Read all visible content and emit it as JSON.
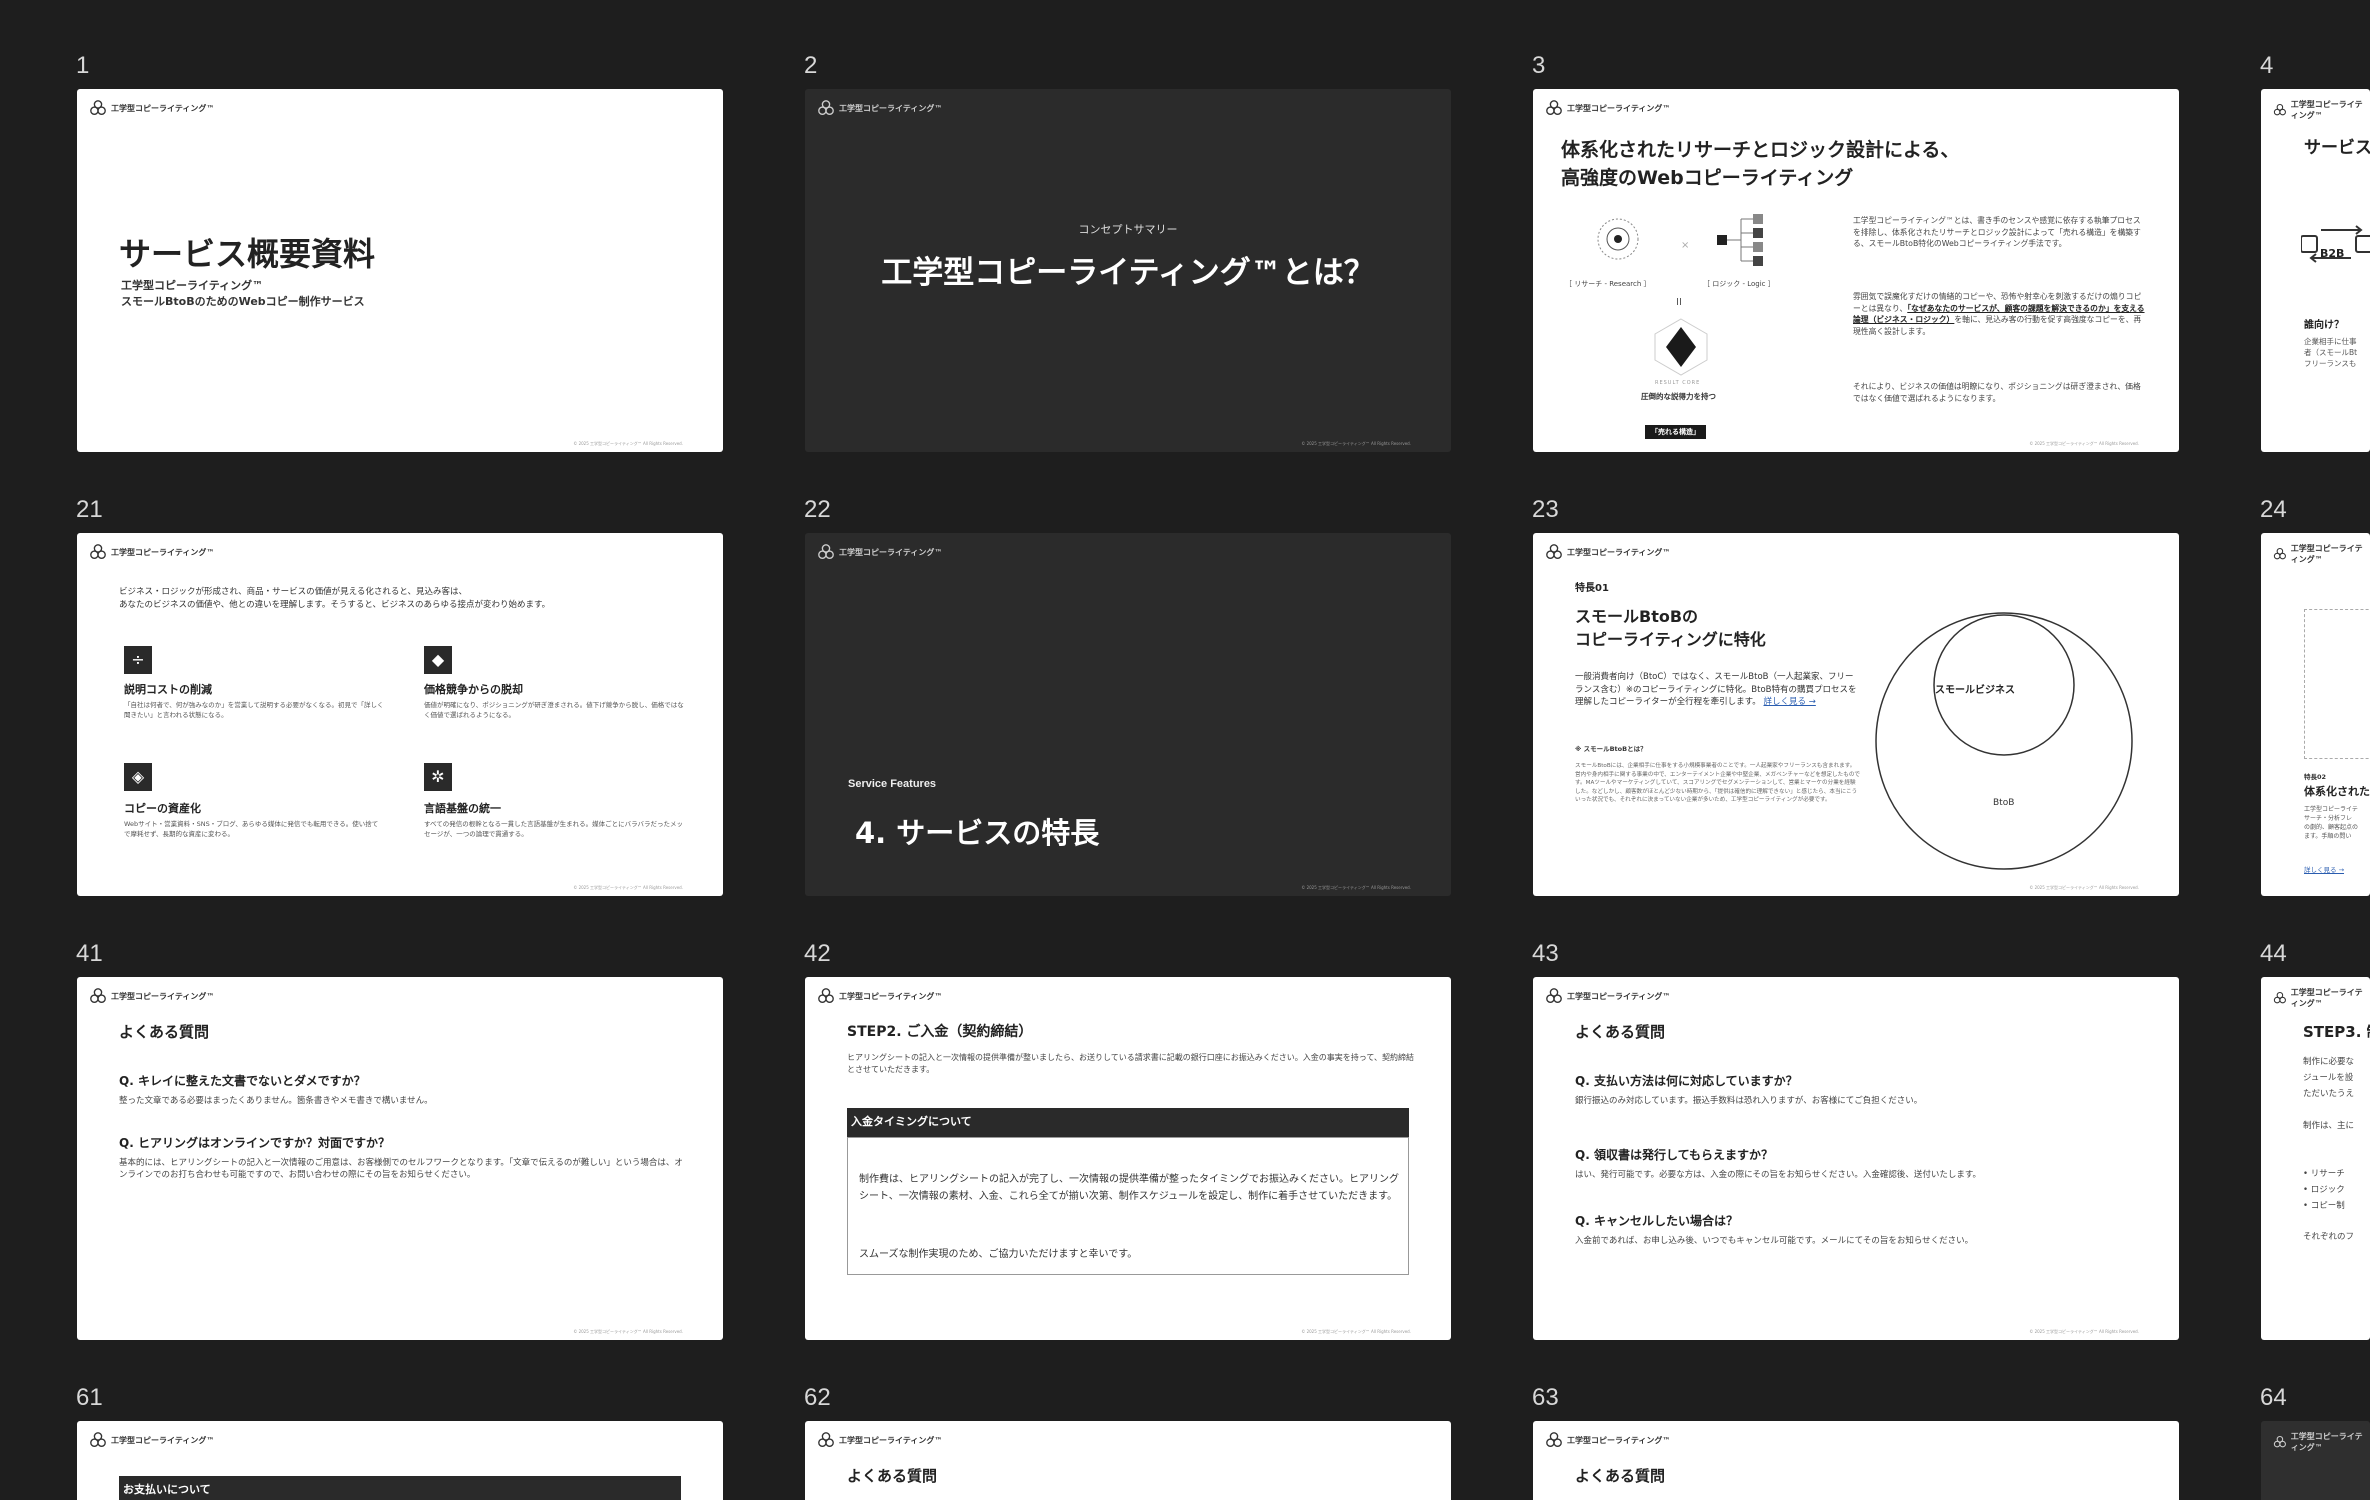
{
  "brand": "工学型コピーライティング™",
  "copyright": "© 2025 工学型コピーライティング™ All Rights Reserved.",
  "numbers": [
    "1",
    "2",
    "3",
    "4",
    "21",
    "22",
    "23",
    "24",
    "41",
    "42",
    "43",
    "44",
    "61",
    "62",
    "63",
    "64"
  ],
  "s1": {
    "title": "サービス概要資料",
    "sub1": "工学型コピーライティング™",
    "sub2": "スモールBtoBのためのWebコピー制作サービス"
  },
  "s2": {
    "eyebrow": "コンセプトサマリー",
    "title": "工学型コピーライティング™とは？"
  },
  "s3": {
    "title1": "体系化されたリサーチとロジック設計による、",
    "title2": "高強度のWebコピーライティング",
    "research": "［ リサーチ - Research ］",
    "logic": "［ ロジック - Logic ］",
    "equals": "II",
    "core": "RESULT CORE",
    "result1": "圧倒的な説得力を持つ",
    "result2": "「売れる構造」",
    "p1": "工学型コピーライティング™とは、書き手のセンスや感覚に依存する執筆プロセスを排除し、体系化されたリサーチとロジック設計によって「売れる構造」を構築する、スモールBtoB特化のWebコピーライティング手法です。",
    "p2a": "雰囲気で誤魔化すだけの情緒的コピーや、恐怖や射幸心を刺激するだけの煽りコピーとは異なり、",
    "p2b": "「なぜあなたのサービスが、顧客の課題を解決できるのか」を支える論理（ビジネス・ロジック）",
    "p2c": "を軸に、見込み客の行動を促す高強度なコピーを、再現性高く設計します。",
    "p3": "それにより、ビジネスの価値は明瞭になり、ポジショニングは研ぎ澄まされ、価格ではなく価値で選ばれるようになります。"
  },
  "s4": {
    "title": "サービス概要",
    "badge": "B2B",
    "q": "誰向け？",
    "a1": "企業相手に仕事",
    "a2": "者（スモールBt",
    "a3": "フリーランスも"
  },
  "s21": {
    "intro1": "ビジネス・ロジックが形成され、商品・サービスの価値が見える化されると、見込み客は、",
    "intro2": "あなたのビジネスの価値や、他との違いを理解します。そうすると、ビジネスのあらゆる接点が変わり始めます。",
    "f1_title": "説明コストの削減",
    "f1_desc": "「自社は何者で、何が強みなのか」を営業して説明する必要がなくなる。初見で「詳しく聞きたい」と言われる状態になる。",
    "f2_title": "価格競争からの脱却",
    "f2_desc": "価値が明確になり、ポジショニングが研ぎ澄まされる。値下げ競争から脱し、価格ではなく価値で選ばれるようになる。",
    "f3_title": "コピーの資産化",
    "f3_desc": "Webサイト・営業資料・SNS・ブログ、あらゆる媒体に発信でも転用できる。使い捨てで摩耗せず、長期的な資産に変わる。",
    "f4_title": "言語基盤の統一",
    "f4_desc": "すべての発信の根幹となる一貫した言語基盤が生まれる。媒体ごとにバラバラだったメッセージが、一つの論理で貫通する。"
  },
  "s22": {
    "eyebrow": "Service Features",
    "title": "4. サービスの特長"
  },
  "s23": {
    "tag": "特長01",
    "title1": "スモールBtoBの",
    "title2": "コピーライティングに特化",
    "body": "一般消費者向け（BtoC）ではなく、スモールBtoB（一人起業家、フリーランス含む）※のコピーライティングに特化。BtoB特有の購買プロセスを理解したコピーライターが全行程を牽引します。",
    "more": "詳しく見る →",
    "note_title": "※ スモールBtoBとは？",
    "note": "スモールBtoBには、企業相手に仕事をする小規模事業者のことです。一人起業家やフリーランスも含まれます。営内や身内相手に関する事業の中で、エンターテイメント企業や中堅企業、メガベンチャーなどを想定したものです。MAツールやマーケティングしていて、スコアリングでセグメンテーションして、営業とマーケの分業を経験した。などしかし、顧客数がほとんど少ない時期から、「提供は確信的に理解できない」と感じたら、本当にこういった状況でも、それぞれに決まっていない企業が多いため、工学型コピーライティングが必要です。",
    "outer": "BtoB",
    "inner": "スモールビジネス"
  },
  "s24": {
    "tag": "特長02",
    "title": "体系化された",
    "desc1": "工学型コピーライテ",
    "desc2": "サーチ・分析フレ",
    "desc3": "の劇的、顧客起点の",
    "desc4": "ます。手順の問い",
    "more": "詳しく見る →"
  },
  "s41": {
    "title": "よくある質問",
    "q1": "Q. キレイに整えた文書でないとダメですか？",
    "a1": "整った文章である必要はまったくありません。箇条書きやメモ書きで構いません。",
    "q2": "Q. ヒアリングはオンラインですか？対面ですか？",
    "a2": "基本的には、ヒアリングシートの記入と一次情報のご用意は、お客様側でのセルフワークとなります。「文章で伝えるのが難しい」という場合は、オンラインでのお打ち合わせも可能ですので、お問い合わせの際にその旨をお知らせください。"
  },
  "s42": {
    "title": "STEP2. ご入金（契約締結）",
    "lead": "ヒアリングシートの記入と一次情報の提供準備が整いましたら、お送りしている請求書に記載の銀行口座にお振込みください。入金の事実を持って、契約締結とさせていただきます。",
    "box_head": "入金タイミングについて",
    "box_p1": "制作費は、ヒアリングシートの記入が完了し、一次情報の提供準備が整ったタイミングでお振込みください。ヒアリングシート、一次情報の素材、入金、これら全てが揃い次第、制作スケジュールを設定し、制作に着手させていただきます。",
    "box_p2": "スムーズな制作実現のため、ご協力いただけますと幸いです。"
  },
  "s43": {
    "title": "よくある質問",
    "q1": "Q. 支払い方法は何に対応していますか？",
    "a1": "銀行振込のみ対応しています。振込手数料は恐れ入りますが、お客様にてご負担ください。",
    "q2": "Q. 領収書は発行してもらえますか？",
    "a2": "はい、発行可能です。必要な方は、入金の際にその旨をお知らせください。入金確認後、送付いたします。",
    "q3": "Q. キャンセルしたい場合は？",
    "a3": "入金前であれば、お申し込み後、いつでもキャンセル可能です。メールにてその旨をお知らせください。"
  },
  "s44": {
    "title": "STEP3. 制",
    "l1": "制作に必要な",
    "l2": "ジュールを設",
    "l3": "ただいたうえ",
    "l4": "制作は、主に",
    "b1": "リサーチ",
    "b2": "ロジック",
    "b3": "コピー制",
    "l5": "それぞれのフ"
  },
  "s61": {
    "head": "お支払いについて"
  },
  "s62": {
    "title": "よくある質問"
  },
  "s63": {
    "title": "よくある質問"
  }
}
